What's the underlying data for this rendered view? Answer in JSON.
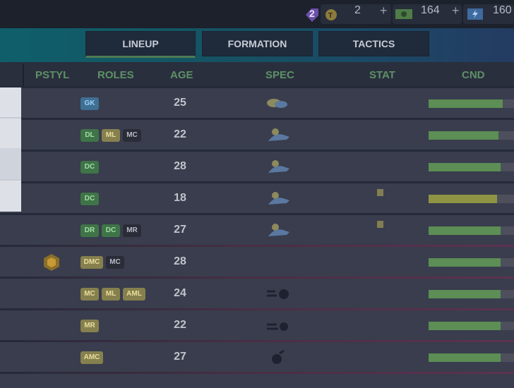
{
  "topbar": {
    "notification_count": "2",
    "tokens": {
      "icon": "token-coin-icon",
      "value": "2",
      "add": "+"
    },
    "cash": {
      "icon": "cash-bill-icon",
      "value": "164",
      "add": "+"
    },
    "energy": {
      "icon": "lightning-card-icon",
      "value": "160"
    }
  },
  "tabs": [
    {
      "label": "LINEUP",
      "active": true
    },
    {
      "label": "FORMATION",
      "active": false
    },
    {
      "label": "TACTICS",
      "active": false
    }
  ],
  "columns": {
    "pstyl": "PSTYL",
    "roles": "ROLES",
    "age": "AGE",
    "spec": "SPEC",
    "stat": "STAT",
    "cnd": "CND"
  },
  "rows": [
    {
      "roles": [
        "GK"
      ],
      "age": "25",
      "spec": "gloves-icon",
      "stat": "",
      "cnd": 0.87
    },
    {
      "roles": [
        "DL",
        "ML",
        "MC"
      ],
      "age": "22",
      "spec": "tackle-slide-icon",
      "stat": "",
      "cnd": 0.82
    },
    {
      "roles": [
        "DC"
      ],
      "age": "28",
      "spec": "tackle-slide-icon",
      "stat": "",
      "cnd": 0.84
    },
    {
      "roles": [
        "DC"
      ],
      "age": "18",
      "spec": "tackle-slide-icon",
      "stat": "yellow-card-icon",
      "cnd": 0.8
    },
    {
      "roles": [
        "DR",
        "DC",
        "MR"
      ],
      "age": "27",
      "spec": "tackle-slide-icon",
      "stat": "yellow-card-icon",
      "cnd": 0.84
    },
    {
      "roles": [
        "DMC",
        "MC"
      ],
      "age": "28",
      "spec": "",
      "stat": "",
      "cnd": 0.84,
      "pstyl": "playstyle-badge-icon"
    },
    {
      "roles": [
        "MC",
        "ML",
        "AML"
      ],
      "age": "24",
      "spec": "dribble-icon",
      "stat": "",
      "cnd": 0.84
    },
    {
      "roles": [
        "MR"
      ],
      "age": "22",
      "spec": "speed-icon",
      "stat": "",
      "cnd": 0.84
    },
    {
      "roles": [
        "AMC"
      ],
      "age": "27",
      "spec": "ball-icon",
      "stat": "",
      "cnd": 0.84
    }
  ],
  "colors": {
    "accent_green": "#5d9167",
    "cnd_green": "#5c8e55",
    "cnd_yellow": "#8e9444"
  }
}
